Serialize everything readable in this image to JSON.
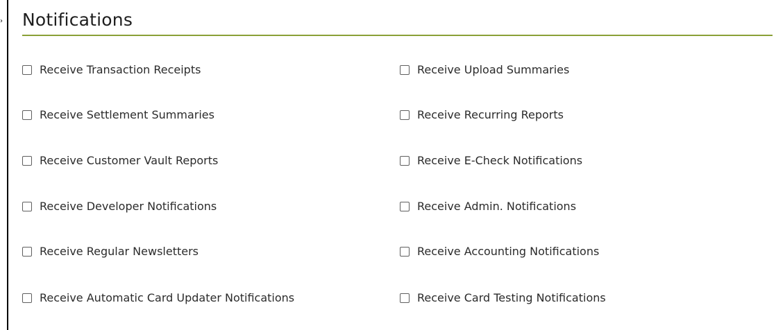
{
  "section": {
    "title": "Notifications"
  },
  "options": {
    "left": [
      "Receive Transaction Receipts",
      "Receive Settlement Summaries",
      "Receive Customer Vault Reports",
      "Receive Developer Notifications",
      "Receive Regular Newsletters",
      "Receive Automatic Card Updater Notifications"
    ],
    "right": [
      "Receive Upload Summaries",
      "Receive Recurring Reports",
      "Receive E-Check Notifications",
      "Receive Admin. Notifications",
      "Receive Accounting Notifications",
      "Receive Card Testing Notifications"
    ],
    "checked": {
      "left": [
        false,
        false,
        false,
        false,
        false,
        false
      ],
      "right": [
        false,
        false,
        false,
        false,
        false,
        false
      ]
    }
  },
  "icons": {
    "checkbox": "checkbox-unchecked-icon",
    "arrow": "caret-right-icon"
  },
  "colors": {
    "accent_rule": "#8aa036",
    "text": "#2b2b2b",
    "checkbox_border": "#5f5f5f"
  }
}
